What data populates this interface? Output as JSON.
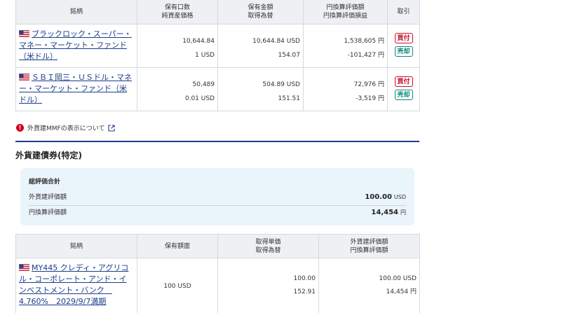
{
  "mmf_table": {
    "headers": {
      "name": "銘柄",
      "qty_line1": "保有口数",
      "qty_line2": "純資産価格",
      "amt_line1": "保有金額",
      "amt_line2": "取得為替",
      "jpy_line1": "円換算評価額",
      "jpy_line2": "円換算評価損益",
      "trade": "取引"
    },
    "rows": [
      {
        "flag": "us-flag-icon",
        "name": "ブラックロック・スーパー・マネー・マーケット・ファンド（米ドル）",
        "qty": "10,644.84",
        "nav": "1 USD",
        "amount": "10,644.84 USD",
        "fx": "154.07",
        "jpy_value": "1,538,605 円",
        "jpy_pl": "-101,427 円",
        "buy": "買付",
        "sell": "売却"
      },
      {
        "flag": "us-flag-icon",
        "name": "ＳＢＩ岡三・ＵＳドル・マネー・マーケット・ファンド（米ドル）",
        "qty": "50,489",
        "nav": "0.01 USD",
        "amount": "504.89 USD",
        "fx": "151.51",
        "jpy_value": "72,976 円",
        "jpy_pl": "-3,519 円",
        "buy": "買付",
        "sell": "売却"
      }
    ]
  },
  "notice": {
    "text": "外貨建MMFの表示について"
  },
  "bond_section": {
    "title": "外貨建債券(特定)"
  },
  "summary": {
    "title": "総評価合計",
    "rows": [
      {
        "label": "外貨建評価額",
        "value": "100.00",
        "unit": "USD"
      },
      {
        "label": "円換算評価額",
        "value": "14,454",
        "unit": "円"
      }
    ]
  },
  "bond_table": {
    "headers": {
      "name": "銘柄",
      "face": "保有額面",
      "cost_line1": "取得単価",
      "cost_line2": "取得為替",
      "val_line1": "外貨建評価額",
      "val_line2": "円換算評価額"
    },
    "rows": [
      {
        "flag": "us-flag-icon",
        "name": "MY445 クレディ・アグリコル・コーポレート・アンド・インベストメント・バンク　4.760%　2029/9/7満期",
        "face": "100 USD",
        "unit_cost": "100.00",
        "fx": "152.91",
        "usd_value": "100.00 USD",
        "jpy_value": "14,454 円"
      }
    ]
  }
}
